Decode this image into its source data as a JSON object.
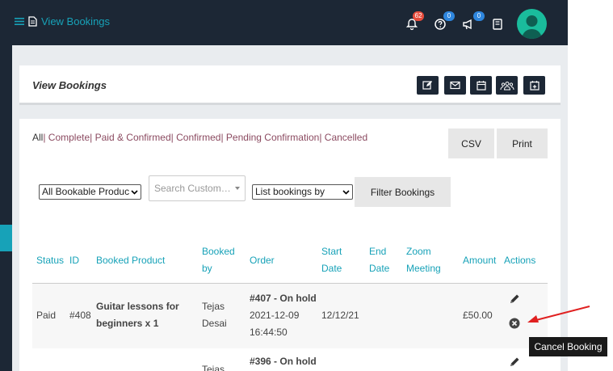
{
  "header": {
    "title": "View Bookings",
    "notifications_count": "62",
    "help_count": "0",
    "announcements_count": "0"
  },
  "card": {
    "title": "View Bookings"
  },
  "filters": {
    "all": "All",
    "complete": "| Complete",
    "paid_confirmed": "| Paid & Confirmed",
    "confirmed": "| Confirmed",
    "pending": "| Pending Confirmation",
    "cancelled": "| Cancelled"
  },
  "export": {
    "csv": "CSV",
    "print": "Print"
  },
  "controls": {
    "product_select": "All Bookable Produc",
    "search_placeholder": "Search Custom…",
    "list_by": "List bookings by",
    "filter_button": "Filter Bookings"
  },
  "table": {
    "headers": {
      "status": "Status",
      "id": "ID",
      "product": "Booked Product",
      "booked_by_1": "Booked",
      "booked_by_2": "by",
      "order": "Order",
      "start_1": "Start",
      "start_2": "Date",
      "end_1": "End",
      "end_2": "Date",
      "zoom_1": "Zoom",
      "zoom_2": "Meeting",
      "amount": "Amount",
      "actions": "Actions"
    },
    "rows": [
      {
        "status": "Paid",
        "id": "#408",
        "product_1": "Guitar lessons for",
        "product_2": "beginners x 1",
        "booked_by_1": "Tejas",
        "booked_by_2": "Desai",
        "order_1": "#407 - On hold",
        "order_2": "2021-12-09",
        "order_3": "16:44:50",
        "start": "12/12/21",
        "amount": "£50.00"
      },
      {
        "order_1": "#396 - On hold",
        "booked_by_1": "Tejas"
      }
    ]
  },
  "tooltip": "Cancel Booking",
  "colors": {
    "navbar": "#1c2735",
    "accent": "#17a2b8",
    "filter_link": "#8b4a60",
    "avatar": "#1abc9c",
    "annotation_arrow": "#e02020"
  }
}
